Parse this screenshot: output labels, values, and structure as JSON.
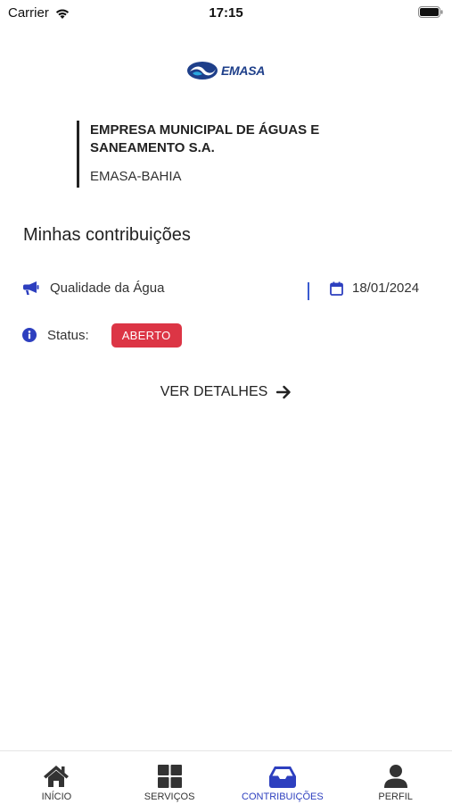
{
  "status_bar": {
    "carrier": "Carrier",
    "time": "17:15"
  },
  "logo": {
    "text": "EMASA"
  },
  "company": {
    "name": "EMPRESA MUNICIPAL DE  ÁGUAS E SANEAMENTO S.A.",
    "subtitle": "EMASA-BAHIA"
  },
  "page": {
    "title": "Minhas contribuições"
  },
  "contribution": {
    "category": "Qualidade da Água",
    "date": "18/01/2024",
    "status_label": "Status:",
    "status_value": "ABERTO",
    "details_label": "VER DETALHES"
  },
  "tabbar": {
    "tabs": [
      {
        "label": "INÍCIO",
        "icon": "home-icon"
      },
      {
        "label": "SERVIÇOS",
        "icon": "grid-icon"
      },
      {
        "label": "CONTRIBUIÇÕES",
        "icon": "inbox-icon",
        "active": true
      },
      {
        "label": "PERFIL",
        "icon": "user-icon"
      }
    ]
  },
  "colors": {
    "accent": "#2d3fbf",
    "badge": "#dc3545",
    "divider": "#3a5bd0"
  }
}
